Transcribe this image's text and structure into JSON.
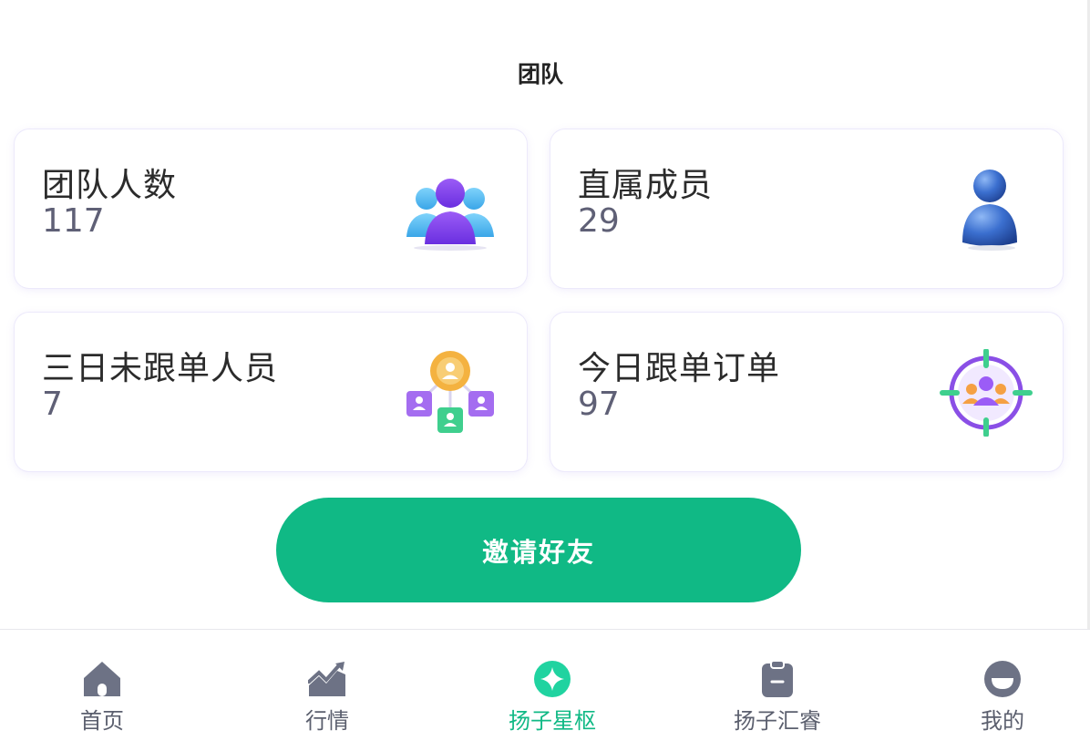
{
  "header": {
    "title": "团队"
  },
  "stats": {
    "team_count": {
      "label": "团队人数",
      "value": "117",
      "icon": "team-group-icon"
    },
    "direct_members": {
      "label": "直属成员",
      "value": "29",
      "icon": "person-icon"
    },
    "inactive_3days": {
      "label": "三日未跟单人员",
      "value": "7",
      "icon": "network-people-icon"
    },
    "today_orders": {
      "label": "今日跟单订单",
      "value": "97",
      "icon": "target-group-icon"
    }
  },
  "invite_button": {
    "label": "邀请好友",
    "color": "#10b985"
  },
  "tabbar": {
    "active_color": "#10b985",
    "inactive_color": "#5b5f6e",
    "items": [
      {
        "label": "首页",
        "icon": "home-icon",
        "active": false
      },
      {
        "label": "行情",
        "icon": "chart-icon",
        "active": false
      },
      {
        "label": "扬子星枢",
        "icon": "star-icon",
        "active": true
      },
      {
        "label": "扬子汇睿",
        "icon": "clipboard-icon",
        "active": false
      },
      {
        "label": "我的",
        "icon": "profile-icon",
        "active": false
      }
    ]
  }
}
